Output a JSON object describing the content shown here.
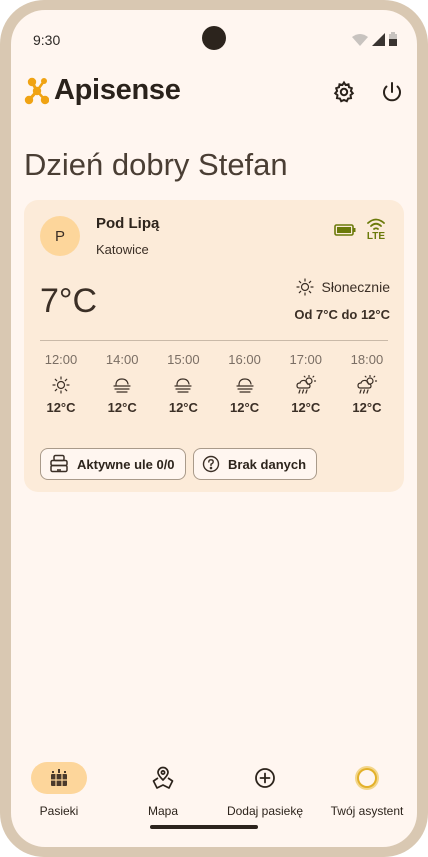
{
  "status_bar": {
    "time": "9:30"
  },
  "header": {
    "app_title": "Apisense",
    "logo_icon": "apisense-logo-icon",
    "settings_icon": "gear-icon",
    "power_icon": "power-icon"
  },
  "greeting": "Dzień dobry Stefan",
  "apiary": {
    "avatar_letter": "P",
    "name": "Pod Lipą",
    "city": "Katowice",
    "battery_icon": "battery-full-icon",
    "signal_label": "LTE",
    "temperature_now": "7°C",
    "condition": "Słonecznie",
    "temp_range": "Od 7°C do 12°C",
    "forecast": [
      {
        "time": "12:00",
        "icon": "sun-icon",
        "temp": "12°C"
      },
      {
        "time": "14:00",
        "icon": "fog-icon",
        "temp": "12°C"
      },
      {
        "time": "15:00",
        "icon": "fog-icon",
        "temp": "12°C"
      },
      {
        "time": "16:00",
        "icon": "fog-icon",
        "temp": "12°C"
      },
      {
        "time": "17:00",
        "icon": "sun-rain-icon",
        "temp": "12°C"
      },
      {
        "time": "18:00",
        "icon": "sun-rain-icon",
        "temp": "12°C"
      }
    ],
    "chips": {
      "active_hives": "Aktywne ule 0/0",
      "no_data": "Brak danych"
    }
  },
  "bottom_nav": {
    "items": [
      {
        "label": "Pasieki",
        "icon": "beehive-grid-icon",
        "active": true
      },
      {
        "label": "Mapa",
        "icon": "map-pin-icon",
        "active": false
      },
      {
        "label": "Dodaj pasiekę",
        "icon": "add-circle-icon",
        "active": false
      },
      {
        "label": "Twój asystent",
        "icon": "assistant-orb-icon",
        "active": false
      }
    ]
  },
  "colors": {
    "background": "#fff6f0",
    "card": "#fcebd9",
    "accent": "#fdd69b",
    "logo": "#f0a313",
    "device_green": "#6b7a0a"
  }
}
